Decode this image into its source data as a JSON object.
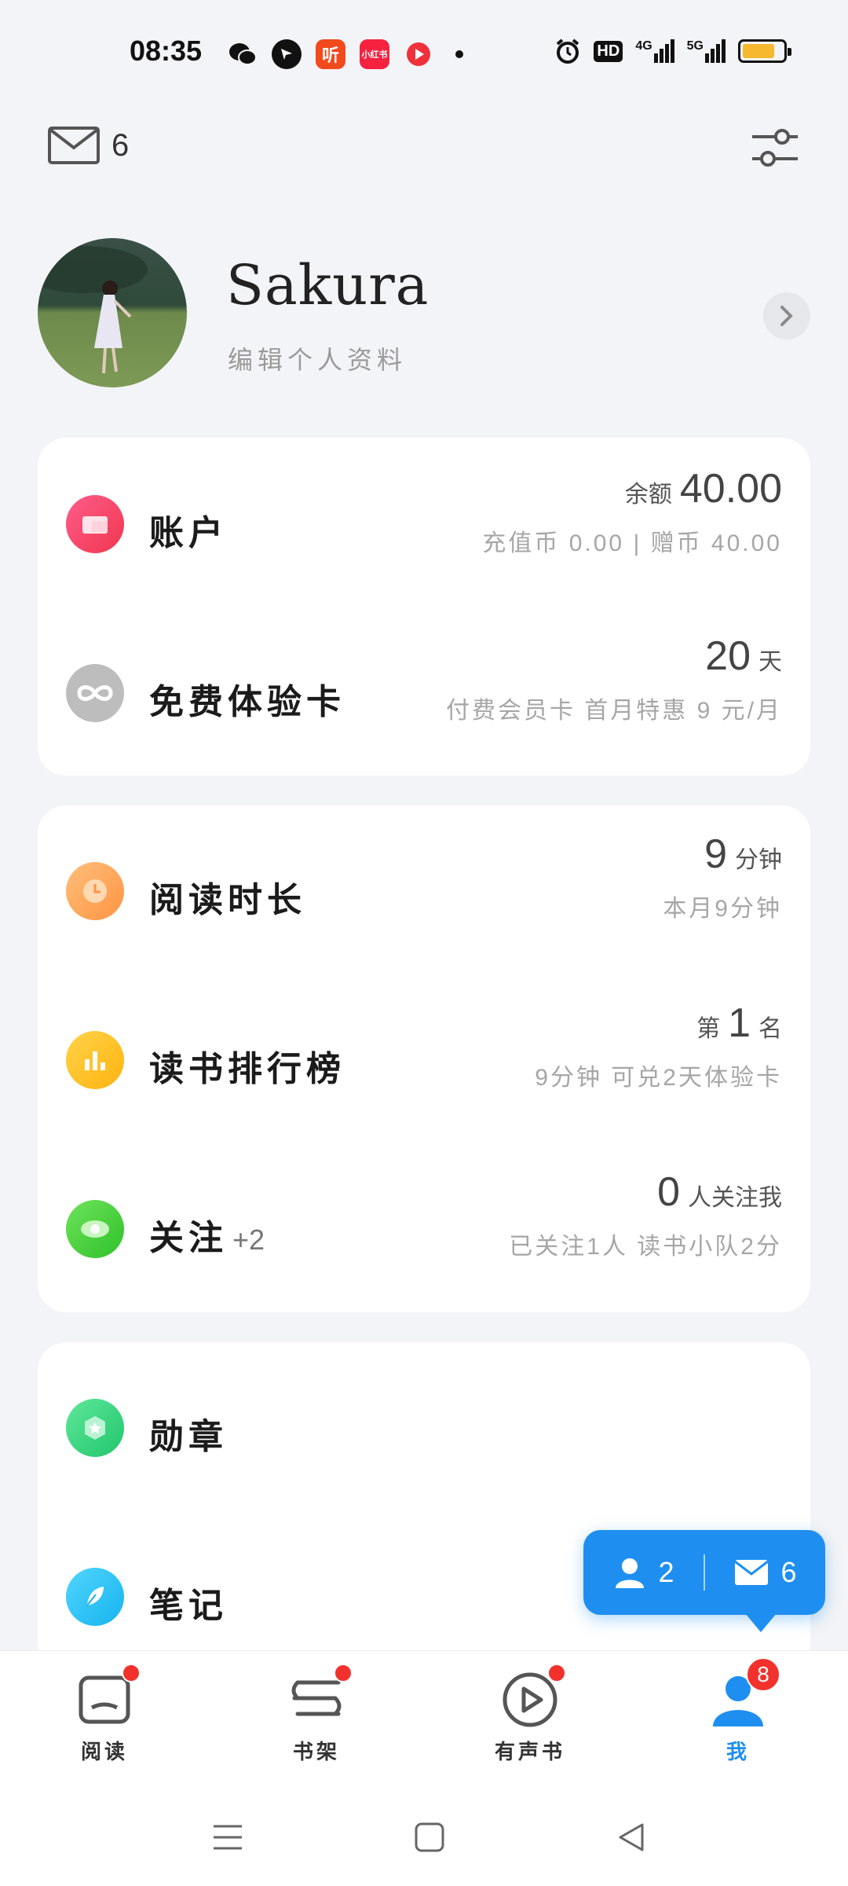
{
  "status_bar": {
    "time": "08:35",
    "app_icons": [
      "wechat-icon",
      "browser-icon",
      "ting-icon",
      "xiaohongshu-icon",
      "video-icon"
    ],
    "ting_label": "听",
    "xhs_label": "小红书",
    "hd_label": "HD",
    "signal1_label": "4G",
    "signal2_label": "5G",
    "battery_level": 0.8
  },
  "top": {
    "mail_count": "6"
  },
  "profile": {
    "name": "Sakura",
    "edit_label": "编辑个人资料"
  },
  "card1": {
    "account": {
      "title": "账户",
      "balance_prefix": "余额",
      "balance": "40.00",
      "detail": "充值币 0.00 | 赠币 40.00",
      "icon_color": "#f43f6e"
    },
    "trial": {
      "title": "免费体验卡",
      "value": "20",
      "unit": "天",
      "detail": "付费会员卡 首月特惠 9 元/月",
      "icon_color": "#b8b8b8"
    }
  },
  "card2": {
    "reading_time": {
      "title": "阅读时长",
      "value": "9",
      "unit": "分钟",
      "detail": "本月9分钟",
      "icon_color": "#ffa75a"
    },
    "ranking": {
      "title": "读书排行榜",
      "prefix": "第",
      "value": "1",
      "unit": "名",
      "detail": "9分钟 可兑2天体验卡",
      "icon_color": "#ffc323"
    },
    "follow": {
      "title": "关注",
      "extra": "+2",
      "value": "0",
      "unit": "人关注我",
      "detail": "已关注1人 读书小队2分",
      "icon_color": "#3fcf35"
    }
  },
  "card3": {
    "medals": {
      "title": "勋章",
      "icon_color": "#2bd47c"
    },
    "notes": {
      "title": "笔记",
      "icon_color": "#22c4f5"
    }
  },
  "bubble": {
    "friends": "2",
    "messages": "6"
  },
  "bottom_nav": {
    "items": [
      {
        "label": "阅读"
      },
      {
        "label": "书架"
      },
      {
        "label": "有声书"
      },
      {
        "label": "我",
        "badge": "8"
      }
    ]
  }
}
